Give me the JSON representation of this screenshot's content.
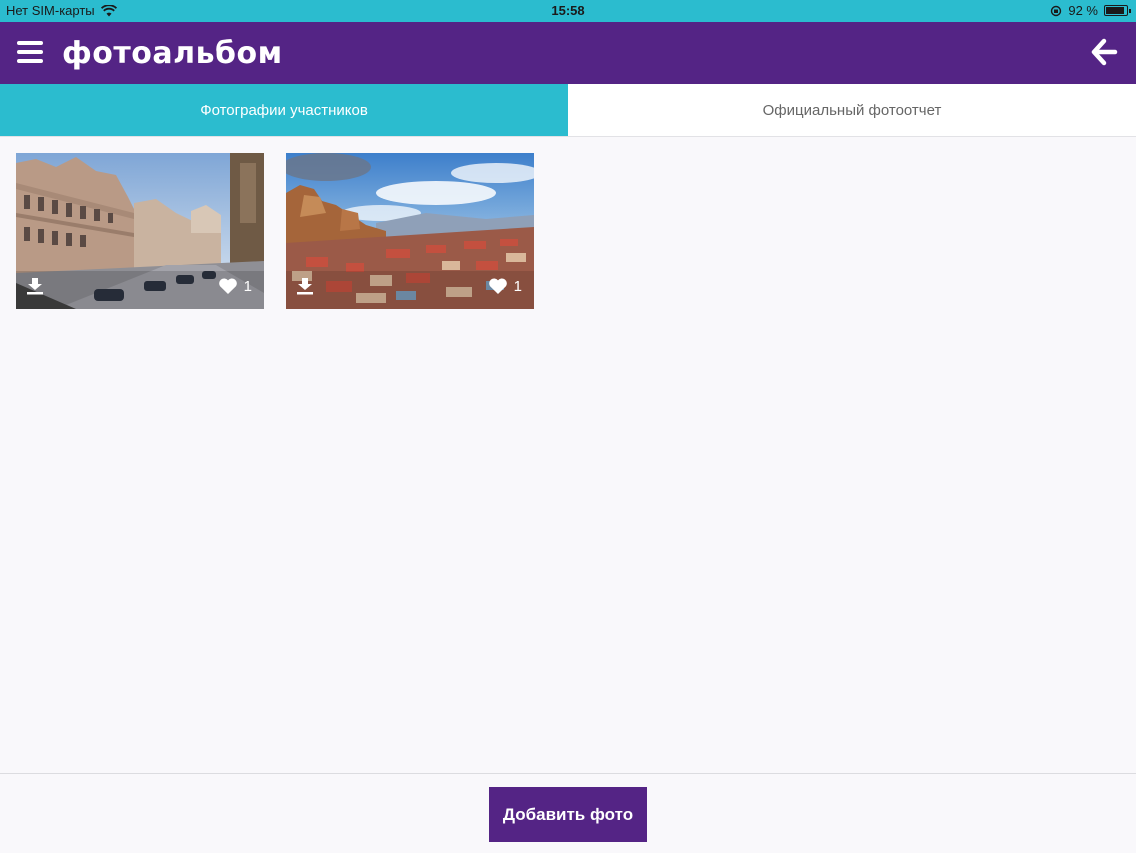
{
  "status_bar": {
    "carrier": "Нет SIM-карты",
    "time": "15:58",
    "battery_percent": "92 %",
    "battery_level": 0.92,
    "icons": [
      "wifi-icon",
      "rotation-lock-icon",
      "battery-icon"
    ]
  },
  "header": {
    "title": "фотоальбом",
    "menu_icon": "hamburger-menu-icon",
    "back_icon": "arrow-left-icon",
    "color": "#542485"
  },
  "tabs": [
    {
      "label": "Фотографии участников",
      "active": true
    },
    {
      "label": "Официальный фотоотчет",
      "active": false
    }
  ],
  "photos": [
    {
      "subject": "street-buildings",
      "likes": "1",
      "download_icon": "download-icon",
      "like_icon": "heart-icon"
    },
    {
      "subject": "city-panorama",
      "likes": "1",
      "download_icon": "download-icon",
      "like_icon": "heart-icon"
    }
  ],
  "footer": {
    "add_button_label": "Добавить фото"
  },
  "colors": {
    "accent_teal": "#2bbccf",
    "brand_purple": "#542485",
    "background": "#f9f8fb"
  }
}
